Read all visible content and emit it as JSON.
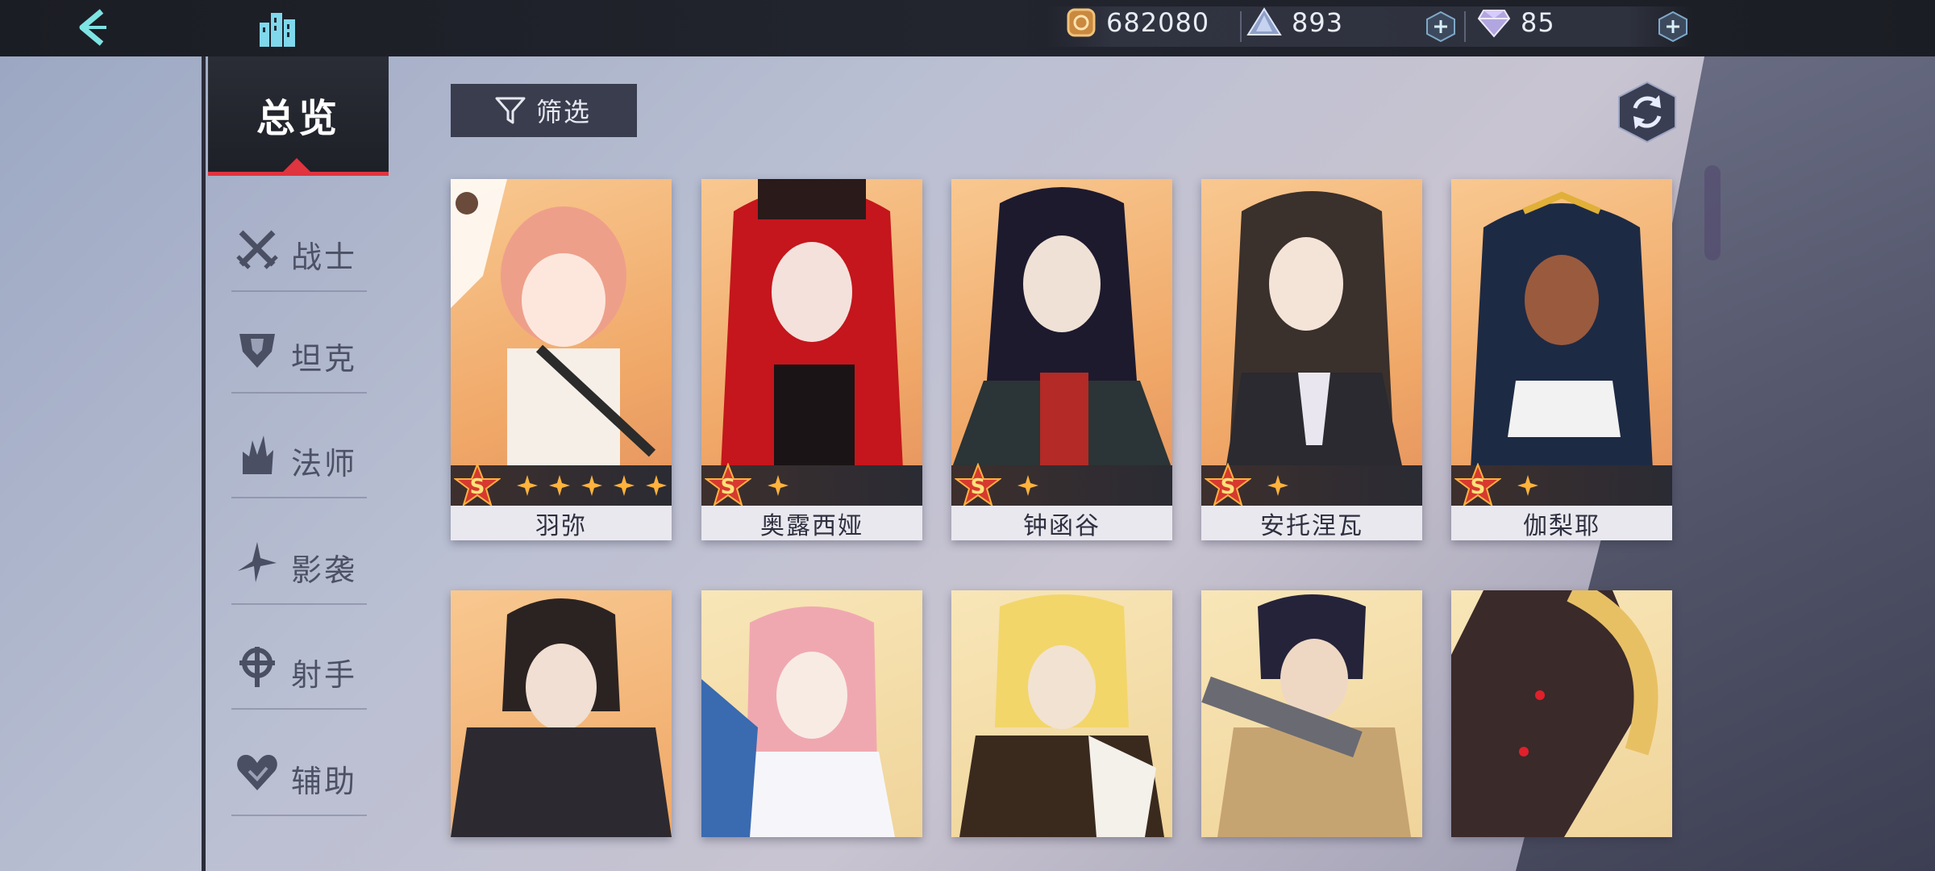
{
  "currency": {
    "gold": "682080",
    "crystal": "893",
    "diamond": "85"
  },
  "sidebar": {
    "overview_label": "总览",
    "items": [
      {
        "label": "战士",
        "icon": "swords-icon"
      },
      {
        "label": "坦克",
        "icon": "armor-icon"
      },
      {
        "label": "法师",
        "icon": "magic-icon"
      },
      {
        "label": "影袭",
        "icon": "shuriken-icon"
      },
      {
        "label": "射手",
        "icon": "crosshair-icon"
      },
      {
        "label": "辅助",
        "icon": "heart-icon"
      }
    ]
  },
  "toolbar": {
    "filter_label": "筛选"
  },
  "heroes_row1": [
    {
      "name": "羽弥",
      "rank": "S",
      "stars": 5
    },
    {
      "name": "奥露西娅",
      "rank": "S",
      "stars": 1
    },
    {
      "name": "钟函谷",
      "rank": "S",
      "stars": 1
    },
    {
      "name": "安托涅瓦",
      "rank": "S",
      "stars": 1
    },
    {
      "name": "伽梨耶",
      "rank": "S",
      "stars": 1
    }
  ],
  "colors": {
    "accent_red": "#e0343f",
    "card_bg_orange": "#f7b878",
    "card_bg_yellow": "#f3e3b0"
  }
}
